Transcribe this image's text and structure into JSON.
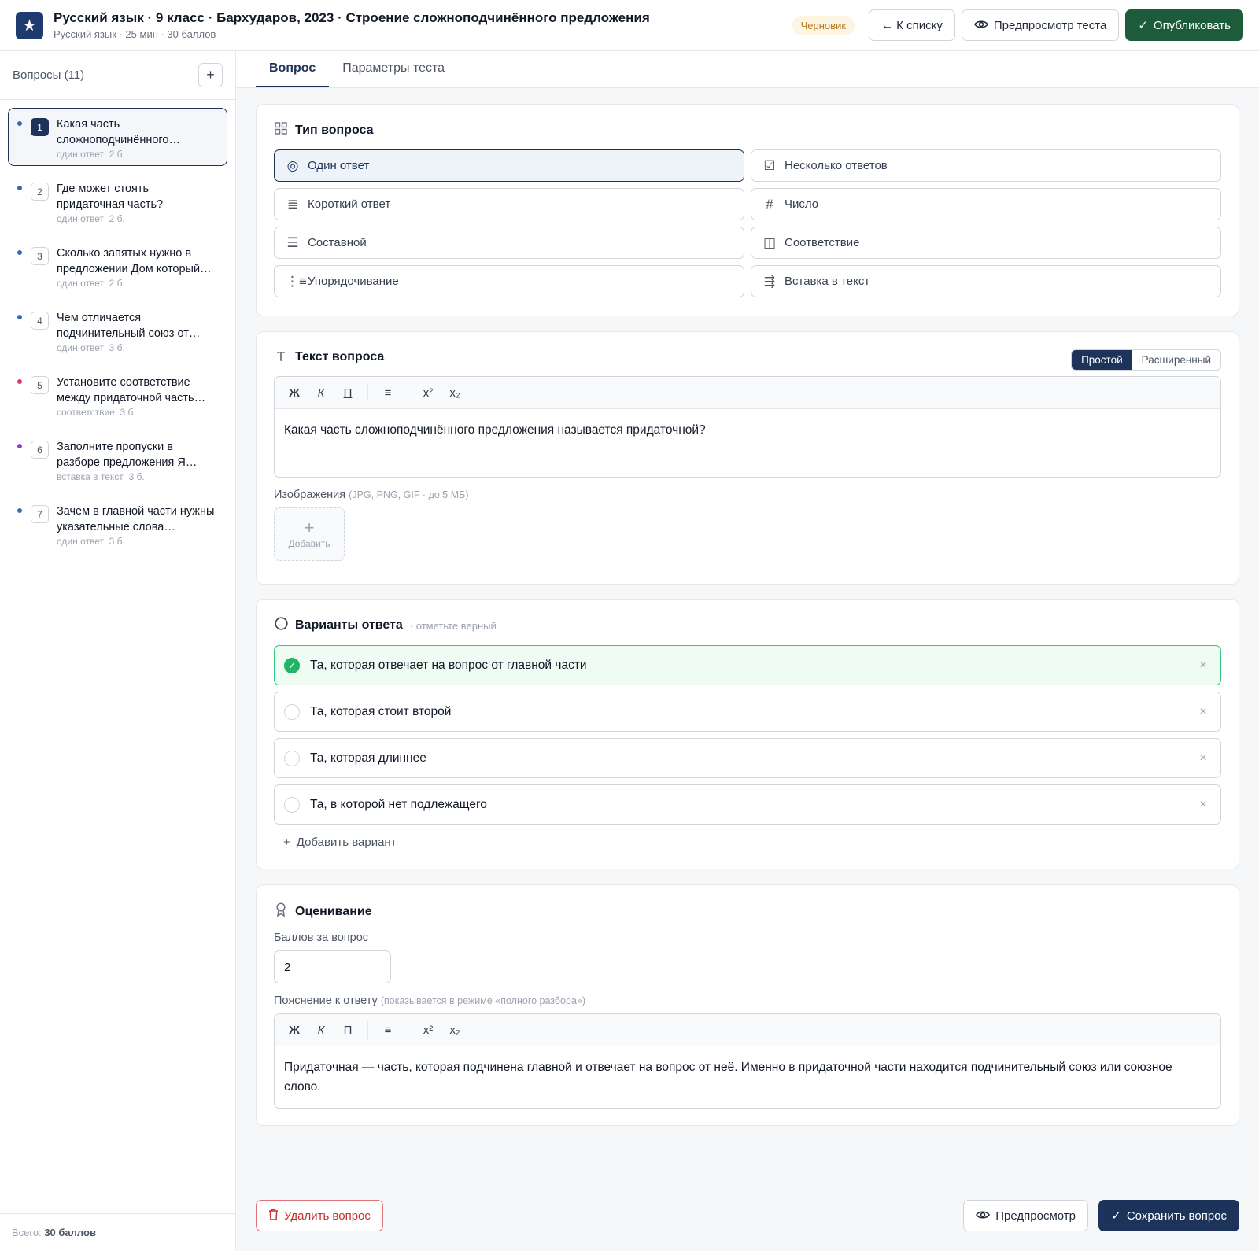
{
  "header": {
    "logo_icon": "star-icon",
    "title": "Русский язык · 9 класс · Бархударов, 2023 · Строение сложноподчинённого предложения",
    "subtitle": "Русский язык · 25 мин · 30 баллов",
    "status": "Черновик",
    "back_label": "← К списку",
    "preview_label": "Предпросмотр теста",
    "publish_label": "Опубликовать"
  },
  "sidebar": {
    "title": "Вопросы (11)",
    "add_label": "+",
    "items": [
      {
        "num": "1",
        "text": "Какая часть сложноподчинённого…",
        "type": "один ответ",
        "points": "2 б.",
        "dot": "#2f6db3"
      },
      {
        "num": "2",
        "text": "Где может стоять придаточная часть?",
        "type": "один ответ",
        "points": "2 б.",
        "dot": "#2f6db3"
      },
      {
        "num": "3",
        "text": "Сколько запятых нужно в предложении Дом который…",
        "type": "один ответ",
        "points": "2 б.",
        "dot": "#2f6db3"
      },
      {
        "num": "4",
        "text": "Чем отличается подчинительный союз от…",
        "type": "один ответ",
        "points": "3 б.",
        "dot": "#2f6db3"
      },
      {
        "num": "5",
        "text": "Установите соответствие между придаточной часть…",
        "type": "соответствие",
        "points": "3 б.",
        "dot": "#d63a6a"
      },
      {
        "num": "6",
        "text": "Заполните пропуски в разборе предложения Я…",
        "type": "вставка в текст",
        "points": "3 б.",
        "dot": "#8b3fd1"
      },
      {
        "num": "7",
        "text": "Зачем в главной части нужны указательные слова…",
        "type": "один ответ",
        "points": "3 б.",
        "dot": "#2f6db3"
      }
    ],
    "footer_prefix": "Всего: ",
    "footer_total": "30 баллов"
  },
  "tabs": [
    {
      "label": "Вопрос"
    },
    {
      "label": "Параметры теста"
    }
  ],
  "question_type": {
    "title": "Тип вопроса",
    "types": [
      {
        "label": "Один ответ",
        "icon": "◎"
      },
      {
        "label": "Несколько ответов",
        "icon": "☑"
      },
      {
        "label": "Короткий ответ",
        "icon": "≣"
      },
      {
        "label": "Число",
        "icon": "#"
      },
      {
        "label": "Составной",
        "icon": "☰"
      },
      {
        "label": "Соответствие",
        "icon": "◫"
      },
      {
        "label": "Упорядочивание",
        "icon": "⋮≡"
      },
      {
        "label": "Вставка в текст",
        "icon": "⇶"
      }
    ]
  },
  "question_text": {
    "title": "Текст вопроса",
    "mode_simple": "Простой",
    "mode_extended": "Расширенный",
    "toolbar": {
      "bold": "Ж",
      "italic": "К",
      "underline": "П",
      "list": "≡",
      "sup": "x²",
      "sub": "x₂"
    },
    "content": "Какая часть сложноподчинённого предложения называется придаточной?",
    "images_label": "Изображения",
    "images_hint": "(JPG, PNG, GIF · до 5 МБ)",
    "add_image_label": "Добавить"
  },
  "answers": {
    "title": "Варианты ответа",
    "hint": "· отметьте верный",
    "options": [
      {
        "text": "Та, которая отвечает на вопрос от главной части",
        "correct": true
      },
      {
        "text": "Та, которая стоит второй",
        "correct": false
      },
      {
        "text": "Та, которая длиннее",
        "correct": false
      },
      {
        "text": "Та, в которой нет подлежащего",
        "correct": false
      }
    ],
    "add_label": "Добавить вариант"
  },
  "grading": {
    "title": "Оценивание",
    "points_label": "Баллов за вопрос",
    "points_value": "2",
    "explanation_label": "Пояснение к ответу",
    "explanation_hint": "(показывается в режиме «полного разбора»)",
    "explanation_text": "Придаточная — часть, которая подчинена главной и отвечает на вопрос от неё. Именно в придаточной части находится подчинительный союз или союзное слово."
  },
  "footer_actions": {
    "delete_label": "Удалить вопрос",
    "preview_label": "Предпросмотр",
    "save_label": "Сохранить вопрос"
  }
}
